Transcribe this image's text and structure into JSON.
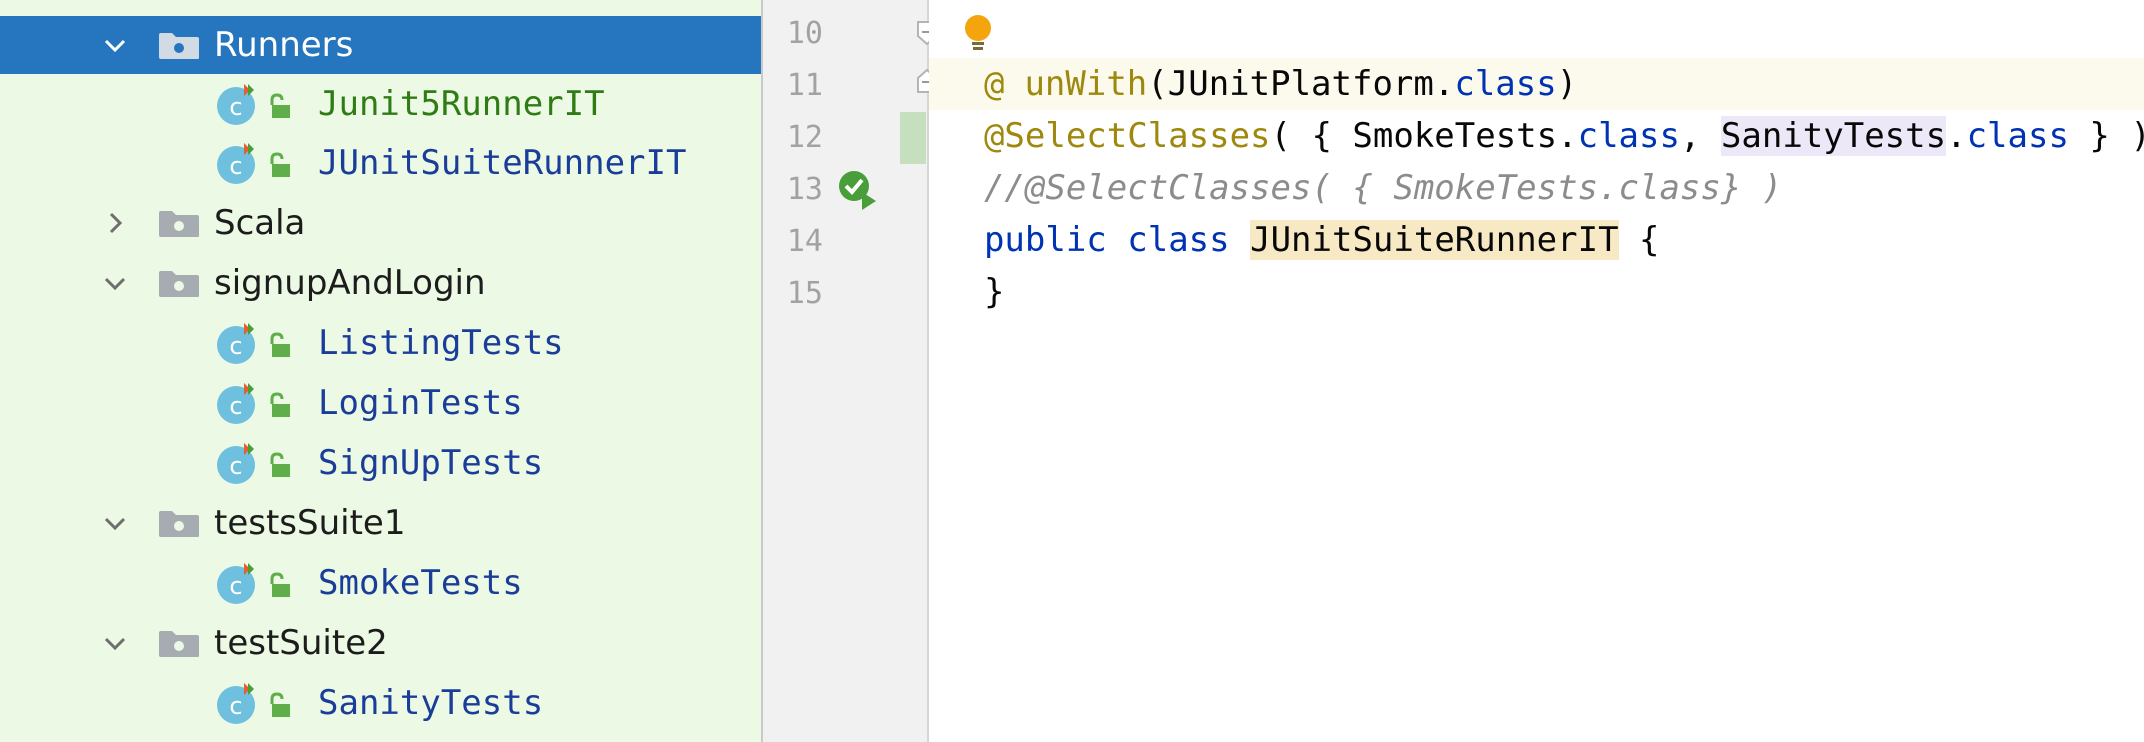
{
  "project_tree": {
    "partial_top_label": "",
    "items": [
      {
        "label": "Runners",
        "kind": "folder",
        "expanded": true,
        "selected": true
      },
      {
        "label": "Junit5RunnerIT",
        "kind": "class"
      },
      {
        "label": "JUnitSuiteRunnerIT",
        "kind": "class"
      },
      {
        "label": "Scala",
        "kind": "folder",
        "expanded": false
      },
      {
        "label": "signupAndLogin",
        "kind": "folder",
        "expanded": true
      },
      {
        "label": "ListingTests",
        "kind": "class"
      },
      {
        "label": "LoginTests",
        "kind": "class"
      },
      {
        "label": "SignUpTests",
        "kind": "class"
      },
      {
        "label": "testsSuite1",
        "kind": "folder",
        "expanded": true
      },
      {
        "label": "SmokeTests",
        "kind": "class"
      },
      {
        "label": "testSuite2",
        "kind": "folder",
        "expanded": true
      },
      {
        "label": "SanityTests",
        "kind": "class"
      }
    ]
  },
  "editor": {
    "line_numbers": [
      "10",
      "11",
      "12",
      "13",
      "14",
      "15"
    ],
    "lines": {
      "l10": {
        "at": "@",
        "annotation_tail": "unWith",
        "open_paren": "(",
        "ident": "JUnitPlatform",
        "dot": ".",
        "kw": "class",
        "close_paren": ")"
      },
      "l11": {
        "annotation": "@SelectClasses",
        "open": "( { ",
        "ident1": "SmokeTests",
        "dot1": ".",
        "kw1": "class",
        "comma": ", ",
        "ident2": "SanityTests",
        "dot2": ".",
        "kw2": "class",
        "close": " } )"
      },
      "l12": {
        "comment": "//@SelectClasses( { SmokeTests.class} )"
      },
      "l13": {
        "kw1": "public",
        "sp1": " ",
        "kw2": "class",
        "sp2": " ",
        "class_name": "JUnitSuiteRunnerIT",
        "brace": " {"
      },
      "l14": {
        "text": "}"
      }
    }
  },
  "colors": {
    "tree_bg": "#ecf9e4",
    "selection": "#2675bf",
    "class_label": "#1a3d9a",
    "modified_label": "#2f7c14",
    "annotation": "#9e880d",
    "keyword": "#0033b3",
    "comment": "#8c8c8c",
    "bulb": "#f4a40c"
  },
  "icons": [
    "chevron-down-icon",
    "chevron-right-icon",
    "folder-icon",
    "class-c-icon",
    "lock-icon",
    "run-test-icon",
    "fold-icon",
    "intention-bulb-icon"
  ]
}
